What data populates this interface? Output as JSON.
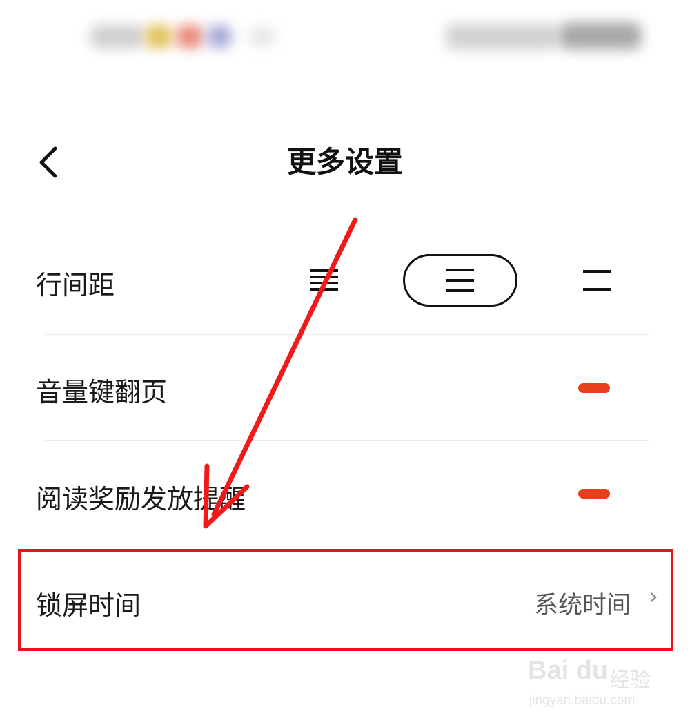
{
  "header": {
    "title": "更多设置",
    "back_icon": "chevron-left-icon"
  },
  "settings": {
    "line_spacing": {
      "label": "行间距",
      "options": [
        "compact-lines-icon",
        "medium-lines-icon",
        "wide-lines-icon"
      ],
      "selected_index": 1
    },
    "volume_key_page_turn": {
      "label": "音量键翻页",
      "toggle_on": true
    },
    "reading_reward_reminder": {
      "label": "阅读奖励发放提醒",
      "toggle_on": true
    },
    "lock_screen_time": {
      "label": "锁屏时间",
      "value": "系统时间",
      "chevron": "›"
    }
  },
  "annotation": {
    "highlight_color": "#e8141c",
    "arrow_color": "#f01a1a"
  },
  "watermark": {
    "brand": "Bai du",
    "cn": "经验",
    "url": "jingyan.baidu.com"
  },
  "colors": {
    "accent": "#e8401c",
    "text": "#1a1a1a",
    "secondary": "#555555"
  }
}
